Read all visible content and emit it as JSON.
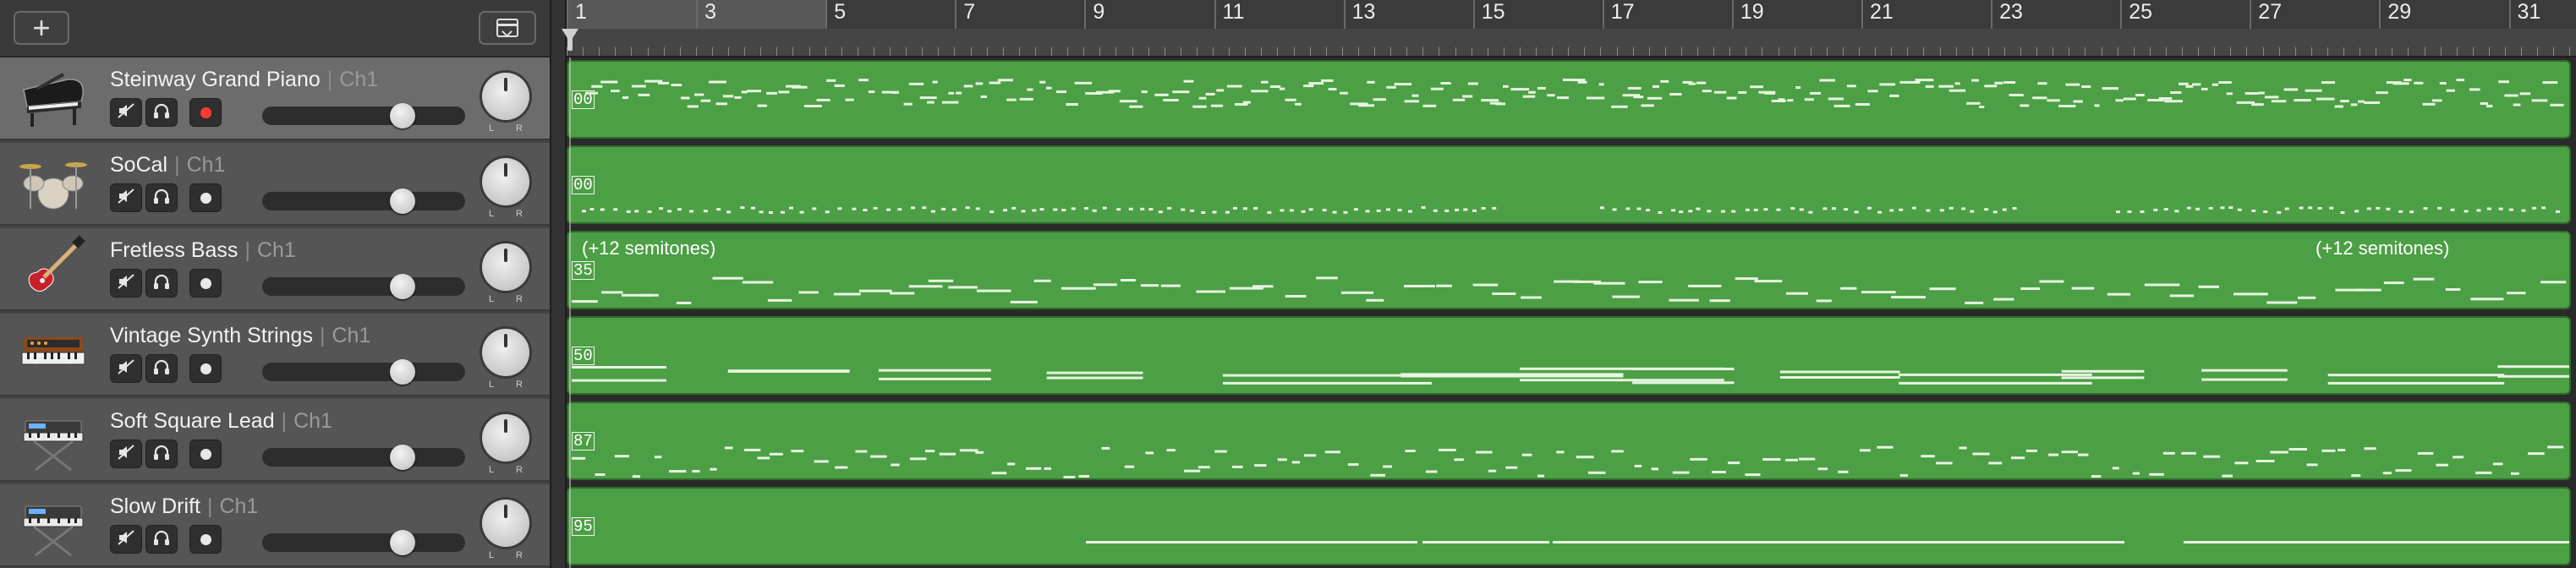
{
  "toolbar": {
    "add_icon": "plus-icon",
    "add_label": "+",
    "menu_icon": "track-tray-icon"
  },
  "ruler": {
    "bars": [
      "1",
      "3",
      "5",
      "7",
      "9",
      "11",
      "13",
      "15",
      "17",
      "19",
      "21",
      "23",
      "25",
      "27",
      "29",
      "31"
    ]
  },
  "tracks": [
    {
      "name": "Steinway Grand Piano",
      "channel": "Ch1",
      "icon": "grand-piano-icon",
      "armed": true,
      "selected": true,
      "volume": 0.72,
      "region_tag": "00",
      "region_label": "",
      "region_label_right": ""
    },
    {
      "name": "SoCal",
      "channel": "Ch1",
      "icon": "drum-kit-icon",
      "armed": false,
      "selected": false,
      "volume": 0.72,
      "region_tag": "00",
      "region_label": "",
      "region_label_right": ""
    },
    {
      "name": "Fretless Bass",
      "channel": "Ch1",
      "icon": "bass-guitar-icon",
      "armed": false,
      "selected": false,
      "volume": 0.72,
      "region_tag": "35",
      "region_label": "(+12 semitones)",
      "region_label_right": "(+12 semitones)"
    },
    {
      "name": "Vintage Synth Strings",
      "channel": "Ch1",
      "icon": "synth-keyboard-icon",
      "armed": false,
      "selected": false,
      "volume": 0.72,
      "region_tag": "50",
      "region_label": "",
      "region_label_right": ""
    },
    {
      "name": "Soft Square Lead",
      "channel": "Ch1",
      "icon": "keyboard-stand-icon",
      "armed": false,
      "selected": false,
      "volume": 0.72,
      "region_tag": "87",
      "region_label": "",
      "region_label_right": ""
    },
    {
      "name": "Slow Drift",
      "channel": "Ch1",
      "icon": "keyboard-stand-icon",
      "armed": false,
      "selected": false,
      "volume": 0.72,
      "region_tag": "95",
      "region_label": "",
      "region_label_right": ""
    }
  ],
  "pan_labels": {
    "left": "L",
    "right": "R"
  },
  "colors": {
    "region": "#4c9f45",
    "region_border": "#2f6a2a",
    "notes": "#e6f6df",
    "record_armed": "#ff3b30"
  }
}
